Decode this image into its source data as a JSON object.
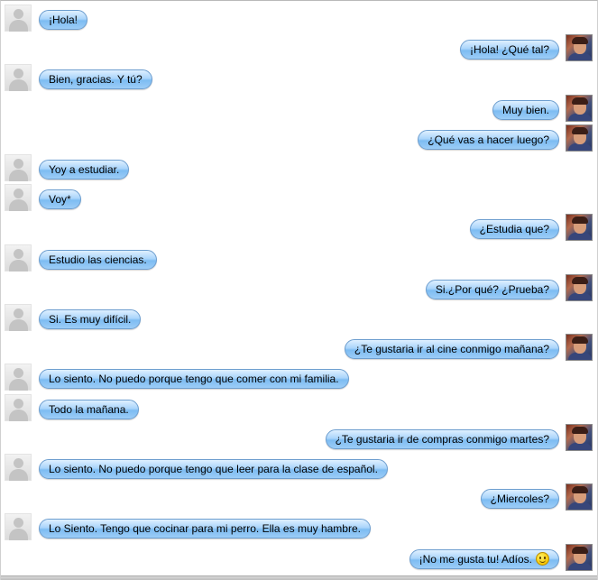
{
  "messages": [
    {
      "side": "left",
      "text": "¡Hola!"
    },
    {
      "side": "right",
      "text": "¡Hola! ¿Qué tal?"
    },
    {
      "side": "left",
      "text": "Bien, gracias. Y tú?"
    },
    {
      "side": "right",
      "text": "Muy bien."
    },
    {
      "side": "right",
      "text": "¿Qué vas a hacer luego?"
    },
    {
      "side": "left",
      "text": "Yoy a estudiar."
    },
    {
      "side": "left",
      "text": "Voy*"
    },
    {
      "side": "right",
      "text": "¿Estudia que?"
    },
    {
      "side": "left",
      "text": "Estudio las ciencias."
    },
    {
      "side": "right",
      "text": "Si.¿Por qué? ¿Prueba?"
    },
    {
      "side": "left",
      "text": "Si. Es muy difícil."
    },
    {
      "side": "right",
      "text": "¿Te gustaria ir al cine conmigo mañana?"
    },
    {
      "side": "left",
      "text": "Lo siento. No puedo porque tengo que comer con mi familia."
    },
    {
      "side": "left",
      "text": "Todo la mañana."
    },
    {
      "side": "right",
      "text": "¿Te gustaria ir de compras conmigo martes?"
    },
    {
      "side": "left",
      "text": "Lo siento. No puedo porque tengo que leer para la clase de español."
    },
    {
      "side": "right",
      "text": "¿Miercoles?"
    },
    {
      "side": "left",
      "text": "Lo Siento. Tengo que cocinar para mi perro. Ella es muy hambre."
    },
    {
      "side": "right",
      "text": "¡No me gusta tu! Adíos.",
      "emoji": "smiley-icon"
    }
  ],
  "colors": {
    "bubble_border": "#6d9ecf",
    "bubble_fill": "#9ccdf7"
  }
}
